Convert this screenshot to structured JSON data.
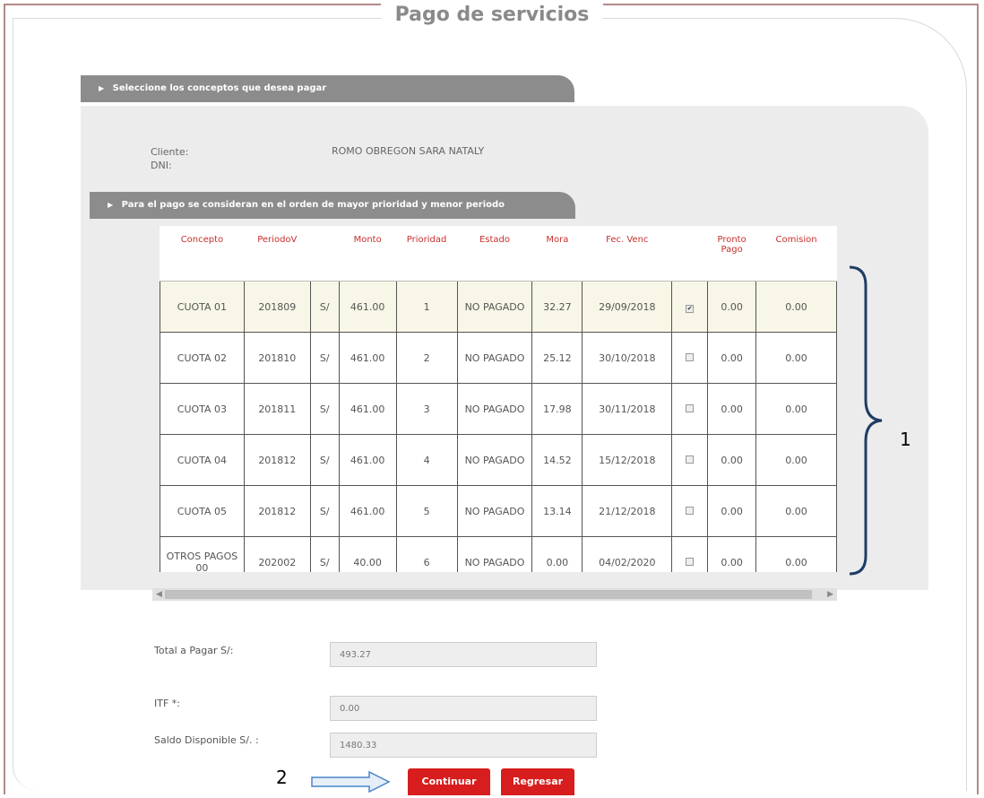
{
  "title": "Pago de servicios",
  "section1": "Seleccione los conceptos que desea pagar",
  "client": {
    "cliente_label": "Cliente:",
    "dni_label": "DNI:",
    "name": "ROMO OBREGON SARA NATALY"
  },
  "section2": "Para el pago se consideran en el orden de mayor prioridad y menor periodo",
  "table": {
    "headers": {
      "concepto": "Concepto",
      "periodo": "PeriodoV",
      "monto": "Monto",
      "prioridad": "Prioridad",
      "estado": "Estado",
      "mora": "Mora",
      "fec_venc": "Fec. Venc",
      "pronto_pago": "Pronto Pago",
      "comision": "Comision"
    },
    "rows": [
      {
        "concepto": "CUOTA 01",
        "periodo": "201809",
        "moneda": "S/",
        "monto": "461.00",
        "prioridad": "1",
        "estado": "NO PAGADO",
        "mora": "32.27",
        "fec_venc": "29/09/2018",
        "checked": true,
        "pronto_pago": "0.00",
        "comision": "0.00"
      },
      {
        "concepto": "CUOTA 02",
        "periodo": "201810",
        "moneda": "S/",
        "monto": "461.00",
        "prioridad": "2",
        "estado": "NO PAGADO",
        "mora": "25.12",
        "fec_venc": "30/10/2018",
        "checked": false,
        "pronto_pago": "0.00",
        "comision": "0.00"
      },
      {
        "concepto": "CUOTA 03",
        "periodo": "201811",
        "moneda": "S/",
        "monto": "461.00",
        "prioridad": "3",
        "estado": "NO PAGADO",
        "mora": "17.98",
        "fec_venc": "30/11/2018",
        "checked": false,
        "pronto_pago": "0.00",
        "comision": "0.00"
      },
      {
        "concepto": "CUOTA 04",
        "periodo": "201812",
        "moneda": "S/",
        "monto": "461.00",
        "prioridad": "4",
        "estado": "NO PAGADO",
        "mora": "14.52",
        "fec_venc": "15/12/2018",
        "checked": false,
        "pronto_pago": "0.00",
        "comision": "0.00"
      },
      {
        "concepto": "CUOTA 05",
        "periodo": "201812",
        "moneda": "S/",
        "monto": "461.00",
        "prioridad": "5",
        "estado": "NO PAGADO",
        "mora": "13.14",
        "fec_venc": "21/12/2018",
        "checked": false,
        "pronto_pago": "0.00",
        "comision": "0.00"
      },
      {
        "concepto": "OTROS PAGOS 00",
        "periodo": "202002",
        "moneda": "S/",
        "monto": "40.00",
        "prioridad": "6",
        "estado": "NO PAGADO",
        "mora": "0.00",
        "fec_venc": "04/02/2020",
        "checked": false,
        "pronto_pago": "0.00",
        "comision": "0.00"
      }
    ]
  },
  "callouts": {
    "one": "1",
    "two": "2"
  },
  "form": {
    "total_label": "Total a Pagar S/:",
    "total_value": "493.27",
    "itf_label": "ITF *:",
    "itf_value": "0.00",
    "saldo_label": "Saldo Disponible S/. :",
    "saldo_value": "1480.33"
  },
  "buttons": {
    "continuar": "Continuar",
    "regresar": "Regresar"
  },
  "colors": {
    "accent_red": "#d71d1d",
    "header_red": "#c8302e",
    "section_gray": "#8c8c8c",
    "arrow_blue": "#4a86c8"
  },
  "icons": {
    "section_arrow": "triangle-right-icon",
    "scroll_left": "scroll-left-icon",
    "scroll_right": "scroll-right-icon"
  }
}
